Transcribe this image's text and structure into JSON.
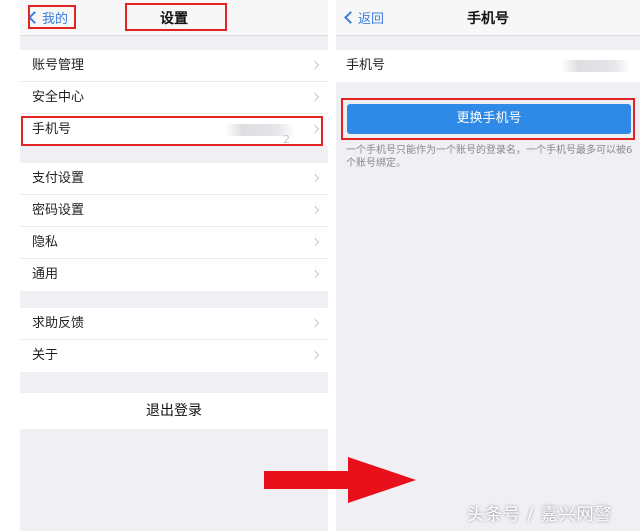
{
  "left_screen": {
    "nav": {
      "back_label": "我的",
      "title": "设置"
    },
    "group1": [
      {
        "label": "账号管理"
      },
      {
        "label": "安全中心"
      },
      {
        "label": "手机号",
        "value_partial": "2"
      }
    ],
    "group2": [
      {
        "label": "支付设置"
      },
      {
        "label": "密码设置"
      },
      {
        "label": "隐私"
      },
      {
        "label": "通用"
      }
    ],
    "group3": [
      {
        "label": "求助反馈"
      },
      {
        "label": "关于"
      }
    ],
    "logout_label": "退出登录"
  },
  "right_screen": {
    "nav": {
      "back_label": "返回",
      "title": "手机号"
    },
    "phone_row_label": "手机号",
    "change_button_label": "更换手机号",
    "hint_text": "一个手机号只能作为一个账号的登录名，一个手机号最多可以被6个账号绑定。"
  },
  "watermark": "头条号 / 嘉兴网警",
  "colors": {
    "accent_blue": "#2e8ae6",
    "highlight_red": "#e02424",
    "background_gray": "#efeff4"
  }
}
